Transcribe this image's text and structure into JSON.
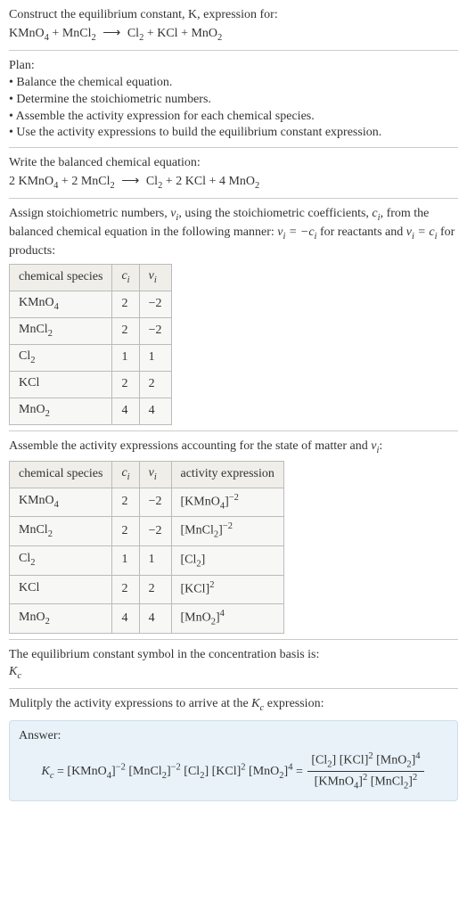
{
  "header": {
    "prompt": "Construct the equilibrium constant, K, expression for:",
    "equation_lhs": "KMnO",
    "equation": {
      "r1": "KMnO",
      "r1s": "4",
      "r2": "MnCl",
      "r2s": "2",
      "p1": "Cl",
      "p1s": "2",
      "p2": "KCl",
      "p3": "MnO",
      "p3s": "2"
    }
  },
  "plan": {
    "title": "Plan:",
    "b1": "• Balance the chemical equation.",
    "b2": "• Determine the stoichiometric numbers.",
    "b3": "• Assemble the activity expression for each chemical species.",
    "b4": "• Use the activity expressions to build the equilibrium constant expression."
  },
  "balanced": {
    "title": "Write the balanced chemical equation:",
    "c_r1": "2",
    "r1": "KMnO",
    "r1s": "4",
    "c_r2": "2",
    "r2": "MnCl",
    "r2s": "2",
    "p1": "Cl",
    "p1s": "2",
    "c_p2": "2",
    "p2": "KCl",
    "c_p3": "4",
    "p3": "MnO",
    "p3s": "2"
  },
  "stoich": {
    "intro1": "Assign stoichiometric numbers, ",
    "intro2": ", using the stoichiometric coefficients, ",
    "intro3": ", from the balanced chemical equation in the following manner: ",
    "intro4": " for reactants and ",
    "intro5": " for products:",
    "nu": "ν",
    "ci": "c",
    "hdr_species": "chemical species",
    "hdr_ci": "c",
    "hdr_nu": "ν",
    "rows": [
      {
        "sp": "KMnO",
        "sub": "4",
        "c": "2",
        "n": "−2"
      },
      {
        "sp": "MnCl",
        "sub": "2",
        "c": "2",
        "n": "−2"
      },
      {
        "sp": "Cl",
        "sub": "2",
        "c": "1",
        "n": "1"
      },
      {
        "sp": "KCl",
        "sub": "",
        "c": "2",
        "n": "2"
      },
      {
        "sp": "MnO",
        "sub": "2",
        "c": "4",
        "n": "4"
      }
    ]
  },
  "activity": {
    "title": "Assemble the activity expressions accounting for the state of matter and ",
    "title_end": ":",
    "hdr_species": "chemical species",
    "hdr_ci": "c",
    "hdr_nu": "ν",
    "hdr_act": "activity expression",
    "rows": [
      {
        "sp": "KMnO",
        "sub": "4",
        "c": "2",
        "n": "−2",
        "a_sp": "KMnO",
        "a_sub": "4",
        "a_exp": "−2"
      },
      {
        "sp": "MnCl",
        "sub": "2",
        "c": "2",
        "n": "−2",
        "a_sp": "MnCl",
        "a_sub": "2",
        "a_exp": "−2"
      },
      {
        "sp": "Cl",
        "sub": "2",
        "c": "1",
        "n": "1",
        "a_sp": "Cl",
        "a_sub": "2",
        "a_exp": ""
      },
      {
        "sp": "KCl",
        "sub": "",
        "c": "2",
        "n": "2",
        "a_sp": "KCl",
        "a_sub": "",
        "a_exp": "2"
      },
      {
        "sp": "MnO",
        "sub": "2",
        "c": "4",
        "n": "4",
        "a_sp": "MnO",
        "a_sub": "2",
        "a_exp": "4"
      }
    ]
  },
  "kc_symbol": {
    "line": "The equilibrium constant symbol in the concentration basis is:",
    "sym": "K",
    "sub": "c"
  },
  "multiply": {
    "line": "Mulitply the activity expressions to arrive at the ",
    "k": "K",
    "ks": "c",
    "line_end": " expression:"
  },
  "answer": {
    "label": "Answer:",
    "Kc": "K",
    "Kcs": "c",
    "t1": "KMnO",
    "t1s": "4",
    "t1e": "−2",
    "t2": "MnCl",
    "t2s": "2",
    "t2e": "−2",
    "t3": "Cl",
    "t3s": "2",
    "t3e": "",
    "t4": "KCl",
    "t4s": "",
    "t4e": "2",
    "t5": "MnO",
    "t5s": "2",
    "t5e": "4",
    "num1": "Cl",
    "num1s": "2",
    "num1e": "",
    "num2": "KCl",
    "num2s": "",
    "num2e": "2",
    "num3": "MnO",
    "num3s": "2",
    "num3e": "4",
    "den1": "KMnO",
    "den1s": "4",
    "den1e": "2",
    "den2": "MnCl",
    "den2s": "2",
    "den2e": "2"
  }
}
